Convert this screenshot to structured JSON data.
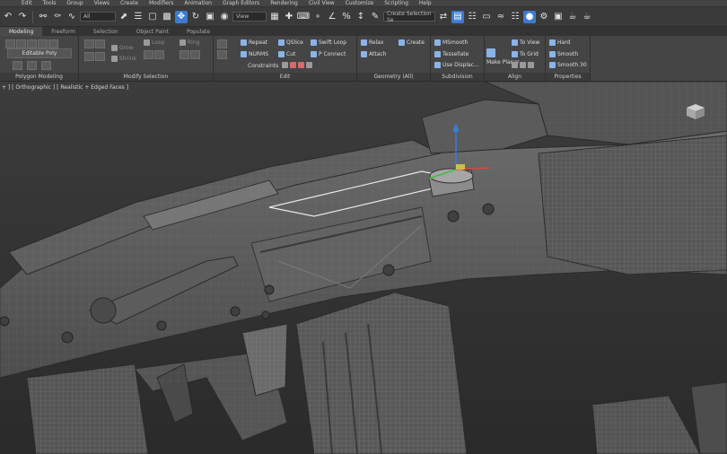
{
  "menu": [
    "Edit",
    "Tools",
    "Group",
    "Views",
    "Create",
    "Modifiers",
    "Animation",
    "Graph Editors",
    "Rendering",
    "Civil View",
    "Customize",
    "Scripting",
    "Help"
  ],
  "toolbar": {
    "selection_filter": "All",
    "ref_coord": "View",
    "named_selection": "Create Selection Se"
  },
  "tabs": [
    "Modeling",
    "Freeform",
    "Selection",
    "Object Paint",
    "Populate"
  ],
  "ribbon": {
    "polygon_modeling": {
      "title": "Polygon Modeling",
      "object_label": "Editable Poly"
    },
    "modify_selection": {
      "title": "Modify Selection",
      "grow": "Grow",
      "shrink": "Shrink",
      "loop": "Loop",
      "ring": "Ring"
    },
    "edit": {
      "title": "Edit",
      "repeat": "Repeat",
      "qslice": "QSlice",
      "swift_loop": "Swift Loop",
      "nurms": "NURMS",
      "cut": "Cut",
      "p_connect": "P Connect",
      "constraints": "Constraints"
    },
    "geometry": {
      "title": "Geometry (All)",
      "relax": "Relax",
      "create": "Create",
      "attach": "Attach"
    },
    "subdivision": {
      "title": "Subdivision",
      "msmooth": "MSmooth",
      "tessellate": "Tessellate",
      "use_displace": "Use Displac..."
    },
    "align": {
      "title": "Align",
      "make_planar": "Make Planar",
      "to_view": "To View",
      "to_grid": "To Grid"
    },
    "properties": {
      "title": "Properties",
      "hard": "Hard",
      "smooth": "Smooth",
      "smooth30": "Smooth 30"
    }
  },
  "viewport": {
    "label": "+ ] [ Orthographic ] [ Realistic + Edged Faces ]"
  },
  "icons": {
    "undo": "undo-icon",
    "redo": "redo-icon",
    "select": "select-icon",
    "move": "move-icon",
    "rotate": "rotate-icon",
    "scale": "scale-icon",
    "render": "teapot-icon"
  },
  "colors": {
    "accent": "#3d7bd0",
    "model": "#5d5d5d",
    "wire": "#9a9a9a"
  }
}
